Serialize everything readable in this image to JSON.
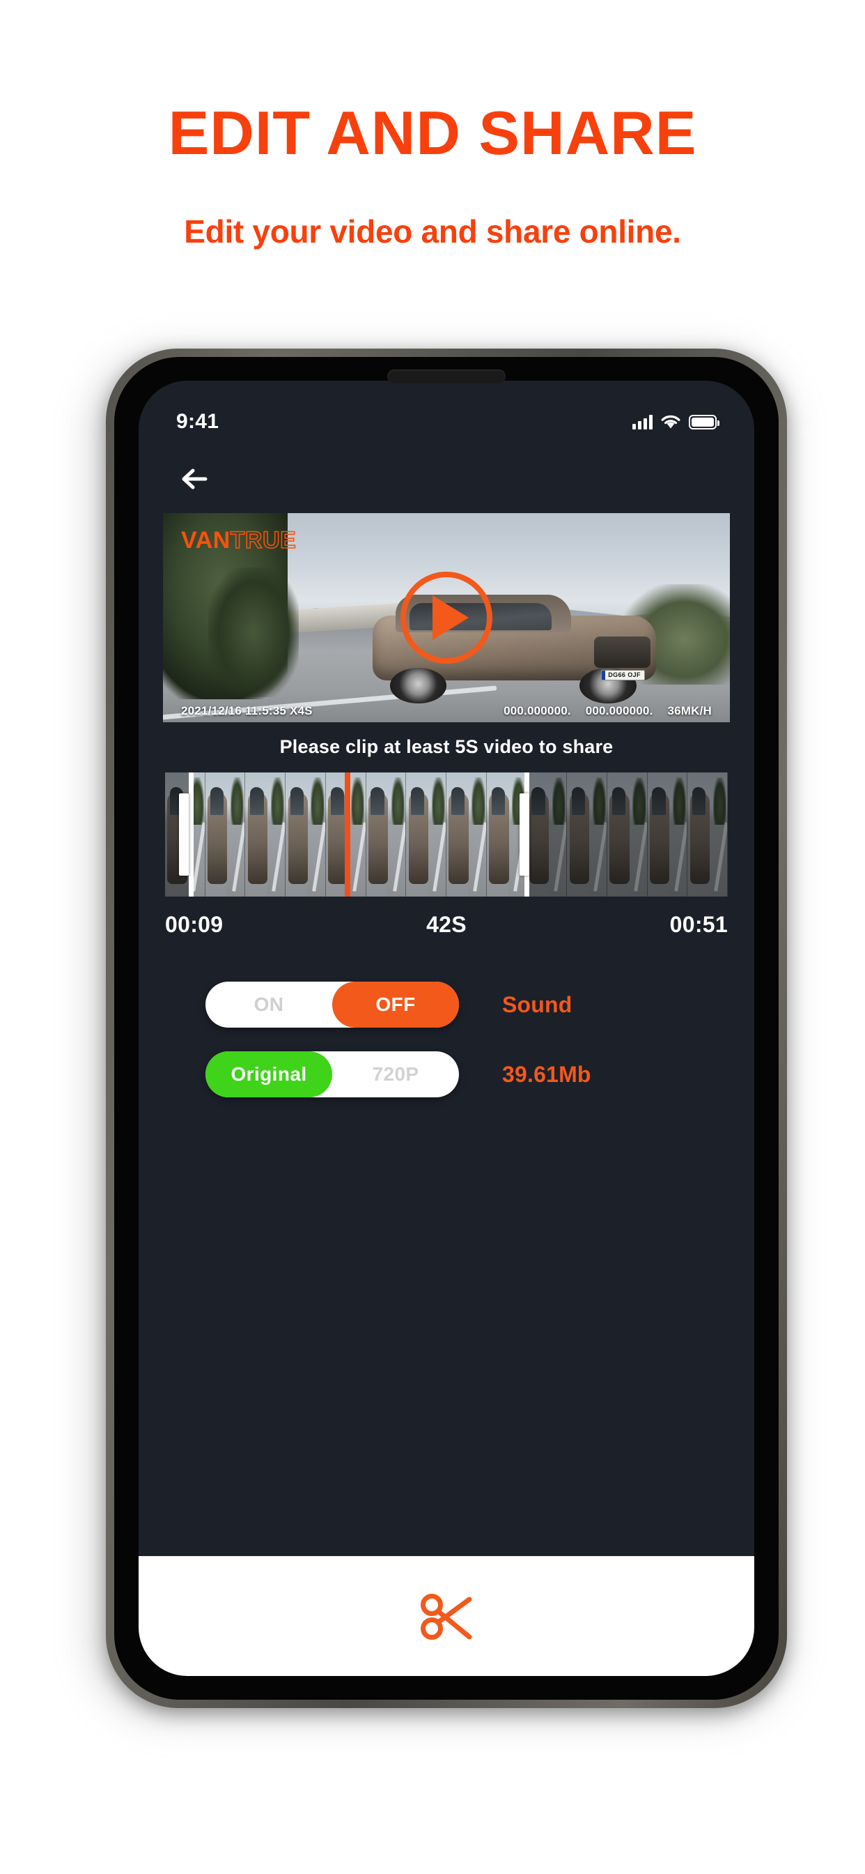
{
  "promo": {
    "headline": "EDIT AND SHARE",
    "subhead": "Edit your video and share online.",
    "accent_color": "#f8400d"
  },
  "phone": {
    "statusbar": {
      "time": "9:41",
      "signal_icon": "cellular-signal-icon",
      "wifi_icon": "wifi-icon",
      "battery_icon": "battery-icon"
    },
    "navbar": {
      "back_icon": "back-arrow-icon"
    },
    "video": {
      "watermark_bold": "VAN",
      "watermark_outline": "TRUE",
      "play_icon": "play-button-icon",
      "plate": "DG66 OJF",
      "osd_left": "2021/12/16  11:5:35   X4S",
      "osd_coord_1": "000.000000.",
      "osd_coord_2": "000.000000.",
      "osd_speed": "36MK/H"
    },
    "hint": "Please clip at least 5S video to share",
    "timeline": {
      "left_handle_name": "trim-start-handle",
      "right_handle_name": "trim-end-handle",
      "playhead_name": "playhead-indicator",
      "playhead_color": "#f2501b"
    },
    "times": {
      "start": "00:09",
      "duration": "42S",
      "end": "00:51"
    },
    "sound_row": {
      "on_label": "ON",
      "off_label": "OFF",
      "selected": "OFF",
      "label": "Sound",
      "active_color": "#f2591b"
    },
    "quality_row": {
      "original_label": "Original",
      "alt_label": "720P",
      "selected": "Original",
      "size_label": "39.61Mb",
      "active_color": "#3fd31a",
      "size_color": "#f2591b"
    },
    "bottom": {
      "cut_icon": "scissors-icon",
      "cut_color": "#f2591b"
    }
  }
}
